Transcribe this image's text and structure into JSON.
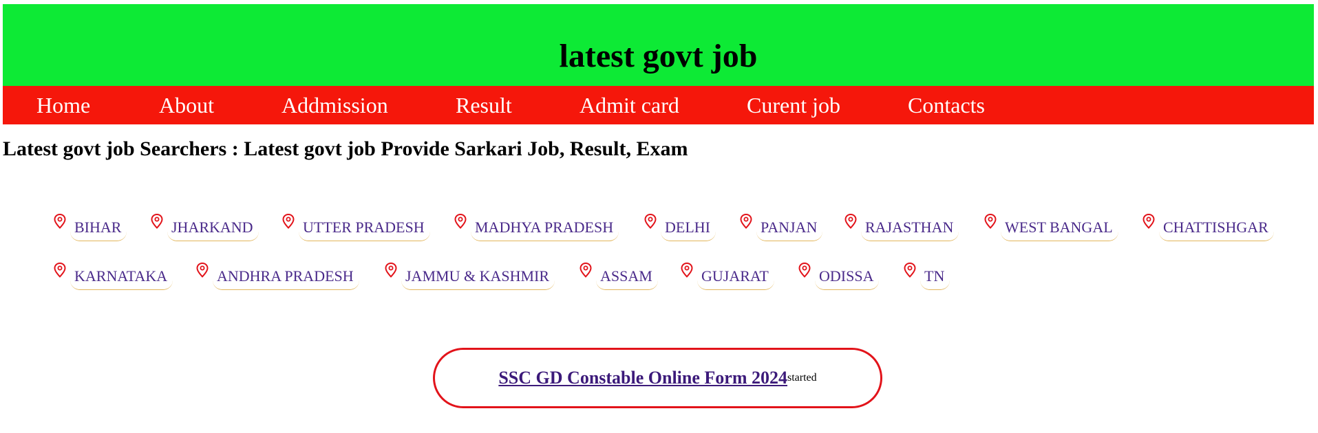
{
  "header": {
    "title": "latest govt job"
  },
  "nav": {
    "items": [
      {
        "label": "Home"
      },
      {
        "label": "About"
      },
      {
        "label": "Addmission"
      },
      {
        "label": "Result"
      },
      {
        "label": "Admit card"
      },
      {
        "label": "Curent job"
      },
      {
        "label": "Contacts"
      }
    ]
  },
  "tagline": "Latest govt job Searchers : Latest govt job Provide Sarkari Job, Result, Exam",
  "states": {
    "icon": "location-pin-icon",
    "pin_color": "#e2131a",
    "row1": [
      "BIHAR",
      "JHARKAND",
      "UTTER PRADESH",
      "MADHYA PRADESH",
      "DELHI",
      "PANJAN",
      "RAJASTHAN",
      "WEST BANGAL",
      "CHATTISHGAR"
    ],
    "row2": [
      "KARNATAKA",
      "ANDHRA PRADESH",
      "JAMMU & KASHMIR",
      "ASSAM",
      "GUJARAT",
      "ODISSA",
      "TN"
    ]
  },
  "notice": {
    "link": "SSC GD Constable Online Form 2024",
    "suffix": "started"
  },
  "colors": {
    "header_bg": "#0dea35",
    "nav_bg": "#f5170b",
    "link": "#4a2a8a",
    "notice_border": "#e2131a"
  }
}
